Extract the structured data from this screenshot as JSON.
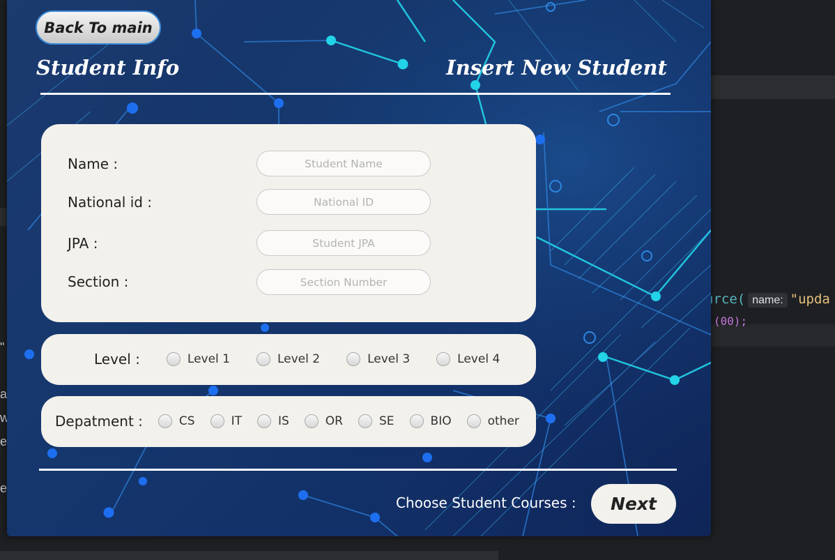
{
  "header": {
    "back_label": "Back To main",
    "title_left": "Student Info",
    "title_right": "Insert New Student"
  },
  "form": {
    "fields": [
      {
        "label": "Name :",
        "placeholder": "Student Name",
        "value": ""
      },
      {
        "label": "National id :",
        "placeholder": "National ID",
        "value": ""
      },
      {
        "label": "JPA :",
        "placeholder": "Student JPA",
        "value": ""
      },
      {
        "label": "Section :",
        "placeholder": "Section Number",
        "value": ""
      }
    ]
  },
  "level": {
    "label": "Level :",
    "options": [
      "Level 1",
      "Level 2",
      "Level 3",
      "Level 4"
    ]
  },
  "department": {
    "label": "Depatment :",
    "options": [
      "CS",
      "IT",
      "IS",
      "OR",
      "SE",
      "BIO",
      "other"
    ]
  },
  "footer": {
    "choose_label": "Choose Student Courses :",
    "next_label": "Next"
  },
  "ide": {
    "code_prefix": "urce(",
    "hint_label": "name:",
    "code_string": "\"upda",
    "code_line2": "(00);",
    "left_chars": [
      "\"",
      "a",
      "w",
      "e",
      "e"
    ]
  },
  "colors": {
    "background_primary": "#15376d",
    "card": "#f3f1ec",
    "circuit_cyan": "#23d3e8",
    "circuit_blue": "#1e6ff0"
  }
}
